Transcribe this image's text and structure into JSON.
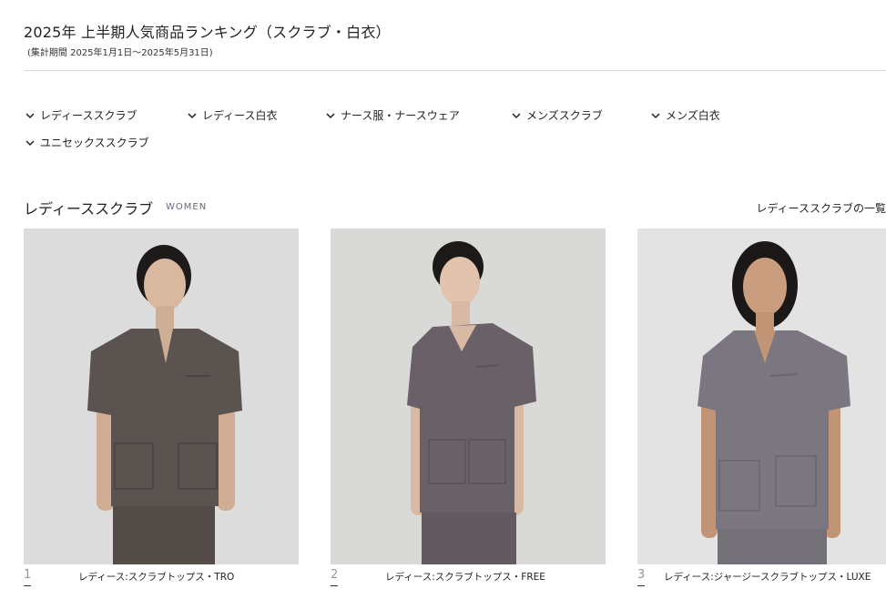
{
  "header": {
    "title": "2025年 上半期人気商品ランキング（スクラブ・白衣）",
    "period": "(集計期間 2025年1月1日〜2025年5月31日)"
  },
  "categories": [
    {
      "label": "レディーススクラブ",
      "icon": "chevron-down-icon"
    },
    {
      "label": "レディース白衣",
      "icon": "chevron-down-icon"
    },
    {
      "label": "ナース服・ナースウェア",
      "icon": "chevron-down-icon"
    },
    {
      "label": "メンズスクラブ",
      "icon": "chevron-down-icon"
    },
    {
      "label": "メンズ白衣",
      "icon": "chevron-down-icon"
    },
    {
      "label": "ユニセックススクラブ",
      "icon": "chevron-down-icon"
    }
  ],
  "section": {
    "title": "レディーススクラブ",
    "subtitle": "WOMEN",
    "link": "レディーススクラブの一覧"
  },
  "products": [
    {
      "rank": "1",
      "name": "レディース:スクラブトップス・TRO",
      "top_color": "#5b5350",
      "bg_color": "#dcdcdc"
    },
    {
      "rank": "2",
      "name": "レディース:スクラブトップス・FREE",
      "top_color": "#6a6168",
      "bg_color": "#d9d9d7"
    },
    {
      "rank": "3",
      "name": "レディース:ジャージースクラブトップス・LUXE",
      "top_color": "#7b767f",
      "bg_color": "#e3e3e3"
    }
  ],
  "colors": {
    "accent_subtitle": "#6e6478",
    "divider": "#dcdcdc",
    "rank_number": "#999999"
  }
}
